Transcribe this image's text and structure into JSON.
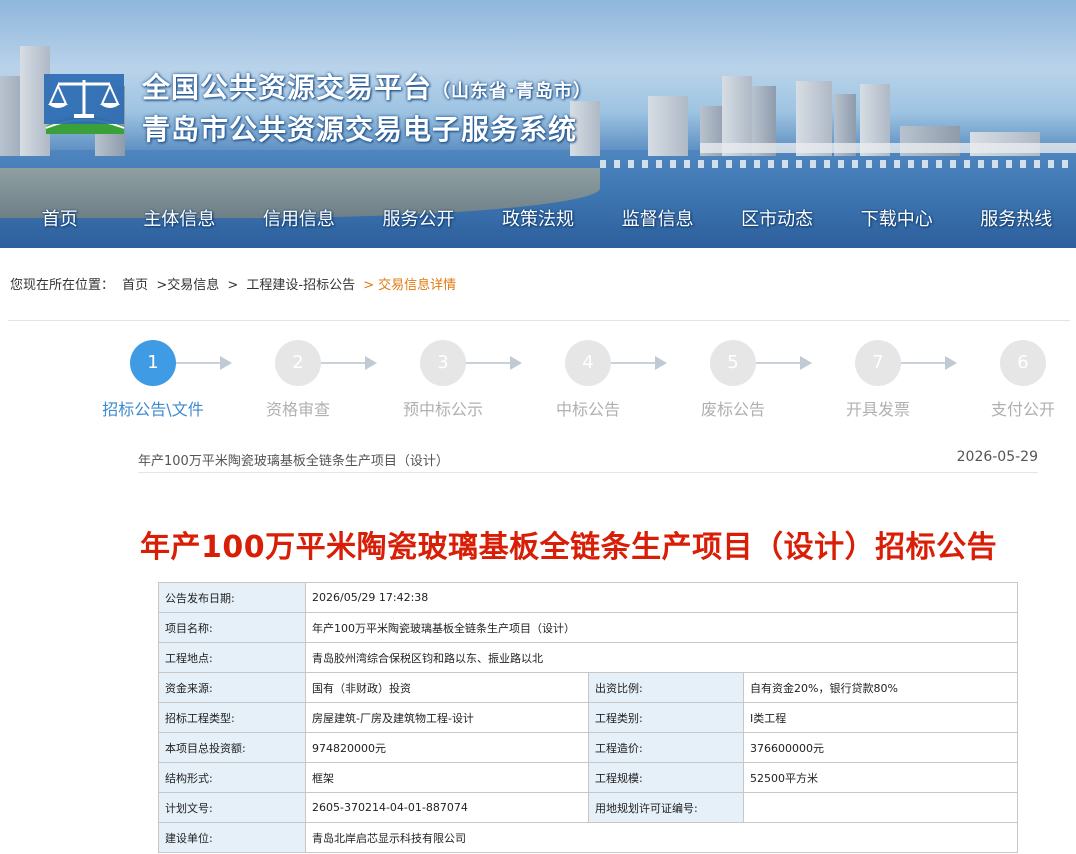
{
  "header": {
    "title_main": "全国公共资源交易平台",
    "title_sub": "（山东省·青岛市）",
    "title_line2": "青岛市公共资源交易电子服务系统"
  },
  "nav": [
    "首页",
    "主体信息",
    "信用信息",
    "服务公开",
    "政策法规",
    "监督信息",
    "区市动态",
    "下载中心",
    "服务热线"
  ],
  "breadcrumb": {
    "prefix": "您现在所在位置：",
    "items": [
      "首页",
      ">交易信息",
      ">",
      "工程建设-招标公告",
      ">"
    ],
    "current": "交易信息详情"
  },
  "steps": [
    {
      "num": "1",
      "label": "招标公告\\文件",
      "active": true
    },
    {
      "num": "2",
      "label": "资格审查"
    },
    {
      "num": "3",
      "label": "预中标公示"
    },
    {
      "num": "4",
      "label": "中标公告"
    },
    {
      "num": "5",
      "label": "废标公告"
    },
    {
      "num": "7",
      "label": "开具发票"
    },
    {
      "num": "6",
      "label": "支付公开"
    }
  ],
  "project": {
    "name": "年产100万平米陶瓷玻璃基板全链条生产项目（设计）",
    "date": "2026-05-29",
    "headline": "年产100万平米陶瓷玻璃基板全链条生产项目（设计）招标公告"
  },
  "info": {
    "publish_date_label": "公告发布日期:",
    "publish_date": "2026/05/29 17:42:38",
    "project_name_label": "项目名称:",
    "project_name": "年产100万平米陶瓷玻璃基板全链条生产项目（设计）",
    "location_label": "工程地点:",
    "location": "青岛胶州湾综合保税区钧和路以东、振业路以北",
    "fund_source_label": "资金来源:",
    "fund_source": "国有（非财政）投资",
    "fund_ratio_label": "出资比例:",
    "fund_ratio": "自有资金20%，银行贷款80%",
    "bid_type_label": "招标工程类型:",
    "bid_type": "房屋建筑-厂房及建筑物工程-设计",
    "project_category_label": "工程类别:",
    "project_category": "Ⅰ类工程",
    "total_invest_label": "本项目总投资额:",
    "total_invest": "974820000元",
    "project_cost_label": "工程造价:",
    "project_cost": "376600000元",
    "structure_label": "结构形式:",
    "structure": "框架",
    "scale_label": "工程规模:",
    "scale": "52500平方米",
    "plan_doc_label": "计划文号:",
    "plan_doc": "2605-370214-04-01-887074",
    "land_permit_label": "用地规划许可证编号:",
    "land_permit": "",
    "builder_label": "建设单位:",
    "builder": "青岛北岸启芯显示科技有限公司"
  }
}
